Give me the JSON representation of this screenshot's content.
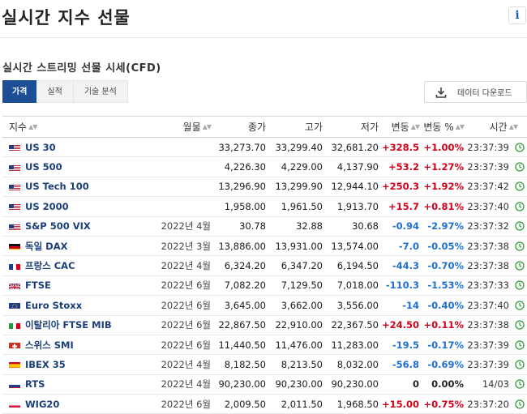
{
  "page": {
    "title": "실시간 지수 선물",
    "info_icon": "i"
  },
  "section": {
    "title": "실시간 스트리밍 선물 시세(CFD)"
  },
  "tabs": [
    {
      "label": "가격",
      "active": true
    },
    {
      "label": "실적",
      "active": false
    },
    {
      "label": "기술 분석",
      "active": false
    }
  ],
  "download": {
    "label": "데이터 다운로드",
    "icon": "download-icon"
  },
  "table": {
    "headers": {
      "name": "지수",
      "month": "월물",
      "last": "종가",
      "high": "고가",
      "low": "저가",
      "chg": "변동",
      "pct": "변동 %",
      "time": "시간"
    },
    "rows": [
      {
        "flag": "us",
        "name": "US 30",
        "month": "",
        "last": "33,273.70",
        "high": "33,299.40",
        "low": "32,681.20",
        "chg": "+328.5",
        "pct": "+1.00%",
        "dir": "pos",
        "time": "23:37:39"
      },
      {
        "flag": "us",
        "name": "US 500",
        "month": "",
        "last": "4,226.30",
        "high": "4,229.00",
        "low": "4,137.90",
        "chg": "+53.2",
        "pct": "+1.27%",
        "dir": "pos",
        "time": "23:37:39"
      },
      {
        "flag": "us",
        "name": "US Tech 100",
        "month": "",
        "last": "13,296.90",
        "high": "13,299.90",
        "low": "12,944.10",
        "chg": "+250.3",
        "pct": "+1.92%",
        "dir": "pos",
        "time": "23:37:42"
      },
      {
        "flag": "us",
        "name": "US 2000",
        "month": "",
        "last": "1,958.00",
        "high": "1,961.50",
        "low": "1,913.70",
        "chg": "+15.7",
        "pct": "+0.81%",
        "dir": "pos",
        "time": "23:37:40"
      },
      {
        "flag": "us",
        "name": "S&P 500 VIX",
        "month": "2022년 4월",
        "last": "30.78",
        "high": "32.88",
        "low": "30.68",
        "chg": "-0.94",
        "pct": "-2.97%",
        "dir": "neg",
        "time": "23:37:32"
      },
      {
        "flag": "de",
        "name": "독일 DAX",
        "month": "2022년 3월",
        "last": "13,886.00",
        "high": "13,931.00",
        "low": "13,574.00",
        "chg": "-7.0",
        "pct": "-0.05%",
        "dir": "neg",
        "time": "23:37:38"
      },
      {
        "flag": "fr",
        "name": "프랑스 CAC",
        "month": "2022년 4월",
        "last": "6,324.20",
        "high": "6,347.20",
        "low": "6,194.50",
        "chg": "-44.3",
        "pct": "-0.70%",
        "dir": "neg",
        "time": "23:37:38"
      },
      {
        "flag": "uk",
        "name": "FTSE",
        "month": "2022년 6월",
        "last": "7,082.20",
        "high": "7,129.50",
        "low": "7,018.00",
        "chg": "-110.3",
        "pct": "-1.53%",
        "dir": "neg",
        "time": "23:37:33"
      },
      {
        "flag": "eu",
        "name": "Euro Stoxx",
        "month": "2022년 6월",
        "last": "3,645.00",
        "high": "3,662.00",
        "low": "3,556.00",
        "chg": "-14",
        "pct": "-0.40%",
        "dir": "neg",
        "time": "23:37:40"
      },
      {
        "flag": "it",
        "name": "이탈리아 FTSE MIB",
        "month": "2022년 6월",
        "last": "22,867.50",
        "high": "22,910.00",
        "low": "22,367.50",
        "chg": "+24.50",
        "pct": "+0.11%",
        "dir": "pos",
        "time": "23:37:38"
      },
      {
        "flag": "ch",
        "name": "스위스 SMI",
        "month": "2022년 6월",
        "last": "11,440.50",
        "high": "11,476.00",
        "low": "11,283.00",
        "chg": "-19.5",
        "pct": "-0.17%",
        "dir": "neg",
        "time": "23:37:39"
      },
      {
        "flag": "es",
        "name": "IBEX 35",
        "month": "2022년 4월",
        "last": "8,182.50",
        "high": "8,213.50",
        "low": "8,032.00",
        "chg": "-56.8",
        "pct": "-0.69%",
        "dir": "neg",
        "time": "23:37:39"
      },
      {
        "flag": "ru",
        "name": "RTS",
        "month": "2022년 4월",
        "last": "90,230.00",
        "high": "90,230.00",
        "low": "90,230.00",
        "chg": "0",
        "pct": "0.00%",
        "dir": "zero",
        "time": "14/03"
      },
      {
        "flag": "pl",
        "name": "WIG20",
        "month": "2022년 6월",
        "last": "2,009.50",
        "high": "2,011.50",
        "low": "1,968.50",
        "chg": "+15.00",
        "pct": "+0.75%",
        "dir": "pos",
        "time": "23:37:20"
      }
    ]
  },
  "colors": {
    "positive": "#d0021b",
    "negative": "#1f6fd1",
    "accent": "#1c4f96",
    "clock": "#2e9b3a"
  }
}
